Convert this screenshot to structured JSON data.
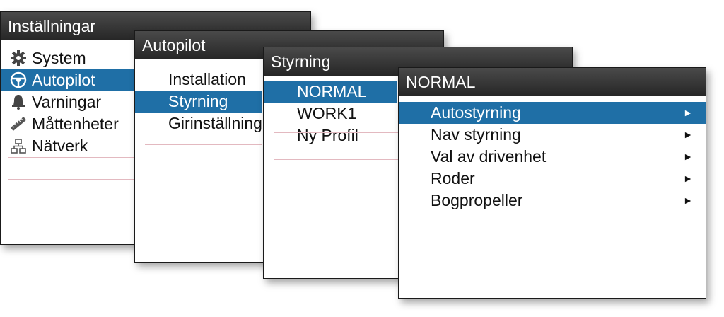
{
  "colors": {
    "selected": "#1f6fa6",
    "header": "#2d2d2d",
    "divider": "#e3b9c0"
  },
  "panels": {
    "settings": {
      "title": "Inställningar",
      "items": [
        {
          "label": "System",
          "icon": "gear-icon"
        },
        {
          "label": "Autopilot",
          "icon": "steering-wheel-icon",
          "selected": true
        },
        {
          "label": "Varningar",
          "icon": "bell-icon"
        },
        {
          "label": "Måttenheter",
          "icon": "ruler-icon"
        },
        {
          "label": "Nätverk",
          "icon": "network-icon"
        }
      ]
    },
    "autopilot": {
      "title": "Autopilot",
      "items": [
        {
          "label": "Installation"
        },
        {
          "label": "Styrning",
          "selected": true
        },
        {
          "label": "Girinställningar"
        }
      ]
    },
    "steering": {
      "title": "Styrning",
      "items": [
        {
          "label": "NORMAL",
          "selected": true
        },
        {
          "label": "WORK1"
        },
        {
          "label": "Ny Profil"
        }
      ]
    },
    "normal": {
      "title": "NORMAL",
      "items": [
        {
          "label": "Autostyrning",
          "selected": true
        },
        {
          "label": "Nav styrning"
        },
        {
          "label": "Val av drivenhet"
        },
        {
          "label": "Roder"
        },
        {
          "label": "Bogpropeller"
        }
      ],
      "arrow_glyph": "►"
    }
  }
}
